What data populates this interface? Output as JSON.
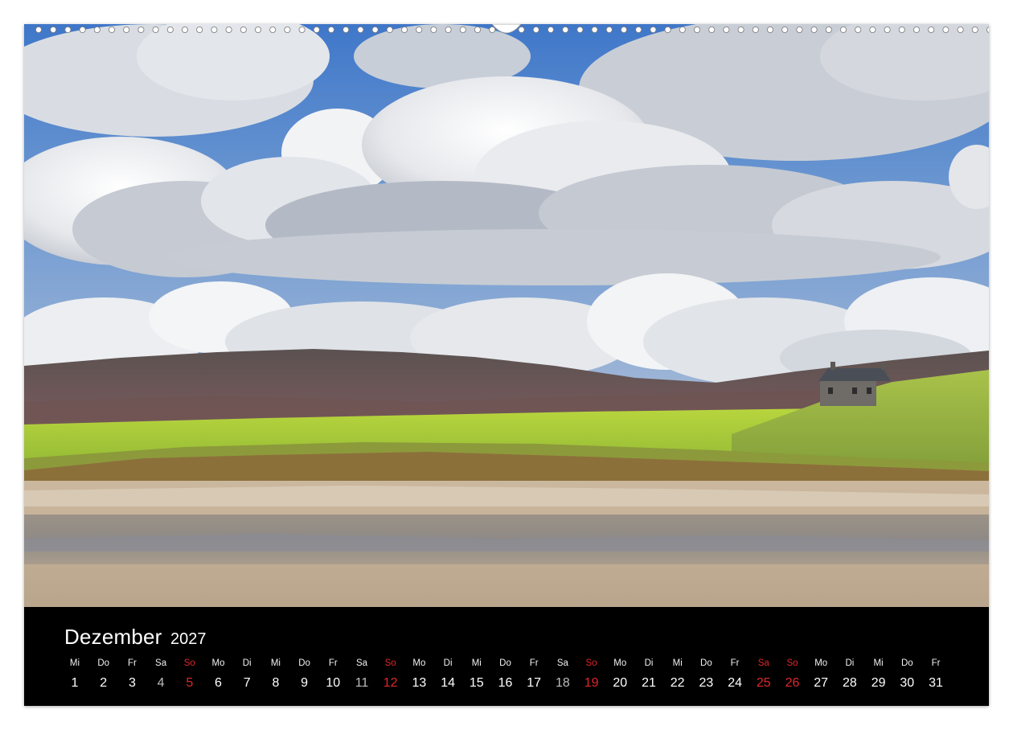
{
  "calendar": {
    "month": "Dezember",
    "year": "2027",
    "days": [
      {
        "wd": "Mi",
        "n": "1",
        "type": "weekday"
      },
      {
        "wd": "Do",
        "n": "2",
        "type": "weekday"
      },
      {
        "wd": "Fr",
        "n": "3",
        "type": "weekday"
      },
      {
        "wd": "Sa",
        "n": "4",
        "type": "sat"
      },
      {
        "wd": "So",
        "n": "5",
        "type": "sun"
      },
      {
        "wd": "Mo",
        "n": "6",
        "type": "weekday"
      },
      {
        "wd": "Di",
        "n": "7",
        "type": "weekday"
      },
      {
        "wd": "Mi",
        "n": "8",
        "type": "weekday"
      },
      {
        "wd": "Do",
        "n": "9",
        "type": "weekday"
      },
      {
        "wd": "Fr",
        "n": "10",
        "type": "weekday"
      },
      {
        "wd": "Sa",
        "n": "11",
        "type": "sat"
      },
      {
        "wd": "So",
        "n": "12",
        "type": "sun"
      },
      {
        "wd": "Mo",
        "n": "13",
        "type": "weekday"
      },
      {
        "wd": "Di",
        "n": "14",
        "type": "weekday"
      },
      {
        "wd": "Mi",
        "n": "15",
        "type": "weekday"
      },
      {
        "wd": "Do",
        "n": "16",
        "type": "weekday"
      },
      {
        "wd": "Fr",
        "n": "17",
        "type": "weekday"
      },
      {
        "wd": "Sa",
        "n": "18",
        "type": "sat"
      },
      {
        "wd": "So",
        "n": "19",
        "type": "sun"
      },
      {
        "wd": "Mo",
        "n": "20",
        "type": "weekday"
      },
      {
        "wd": "Di",
        "n": "21",
        "type": "weekday"
      },
      {
        "wd": "Mi",
        "n": "22",
        "type": "weekday"
      },
      {
        "wd": "Do",
        "n": "23",
        "type": "weekday"
      },
      {
        "wd": "Fr",
        "n": "24",
        "type": "weekday"
      },
      {
        "wd": "Sa",
        "n": "25",
        "type": "sun"
      },
      {
        "wd": "So",
        "n": "26",
        "type": "sun"
      },
      {
        "wd": "Mo",
        "n": "27",
        "type": "weekday"
      },
      {
        "wd": "Di",
        "n": "28",
        "type": "weekday"
      },
      {
        "wd": "Mi",
        "n": "29",
        "type": "weekday"
      },
      {
        "wd": "Do",
        "n": "30",
        "type": "weekday"
      },
      {
        "wd": "Fr",
        "n": "31",
        "type": "weekday"
      }
    ]
  },
  "colors": {
    "background": "#000000",
    "text": "#ffffff",
    "saturday": "#bdbdbd",
    "holiday": "#e0262a"
  },
  "photo": {
    "icon": "scottish-beach-landscape-photo"
  }
}
